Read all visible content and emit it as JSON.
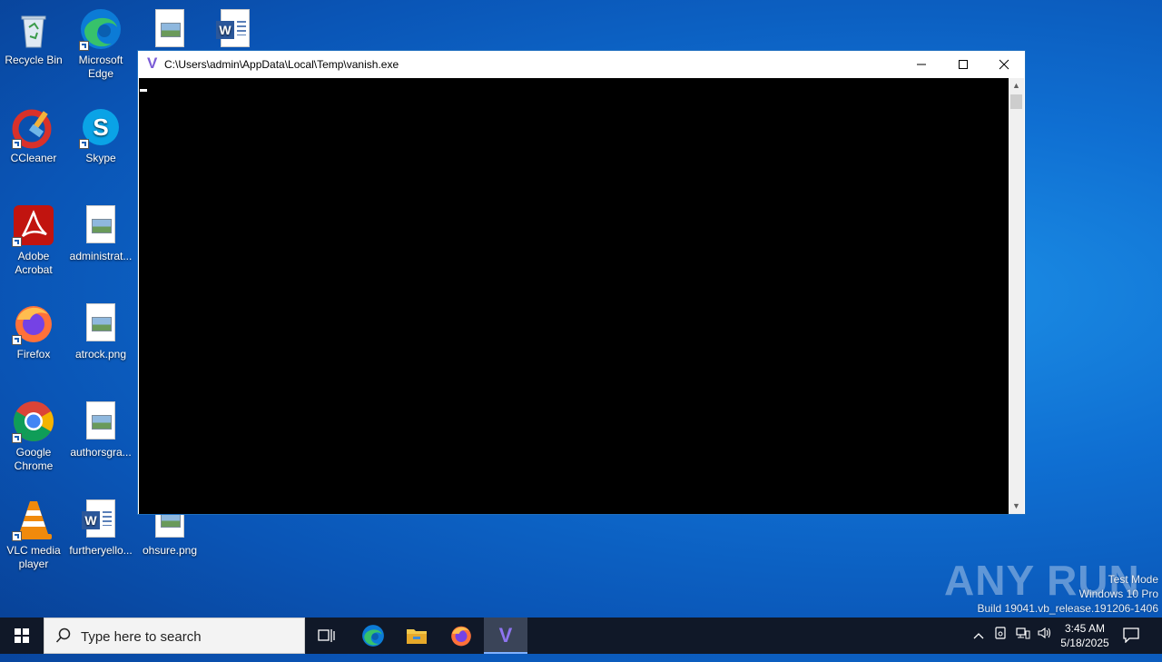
{
  "desktop": {
    "icons": [
      {
        "name": "recycle-bin",
        "label": "Recycle Bin"
      },
      {
        "name": "microsoft-edge",
        "label": "Microsoft Edge"
      },
      {
        "name": "ccleaner",
        "label": "CCleaner"
      },
      {
        "name": "skype",
        "label": "Skype"
      },
      {
        "name": "adobe-acrobat",
        "label": "Adobe Acrobat"
      },
      {
        "name": "administrat",
        "label": "administrat..."
      },
      {
        "name": "firefox",
        "label": "Firefox"
      },
      {
        "name": "atrock",
        "label": "atrock.png"
      },
      {
        "name": "google-chrome",
        "label": "Google Chrome"
      },
      {
        "name": "authorsgra",
        "label": "authorsgra..."
      },
      {
        "name": "vlc",
        "label": "VLC media player"
      },
      {
        "name": "furtheryello",
        "label": "furtheryello..."
      },
      {
        "name": "ohsure",
        "label": "ohsure.png"
      }
    ]
  },
  "window": {
    "title": "C:\\Users\\admin\\AppData\\Local\\Temp\\vanish.exe",
    "app_glyph": "V",
    "minimize": "—",
    "maximize": "☐",
    "close": "✕"
  },
  "watermark": {
    "brand": "ANY RUN",
    "line1": "Test Mode",
    "line2": "Windows 10 Pro",
    "line3": "Build 19041.vb_release.191206-1406"
  },
  "taskbar": {
    "search_placeholder": "Type here to search",
    "active_glyph": "V",
    "time": "3:45 AM",
    "date": "5/18/2025"
  },
  "colors": {
    "desktop": "#0f6fd2",
    "taskbar": "#101828",
    "console": "#000000"
  }
}
